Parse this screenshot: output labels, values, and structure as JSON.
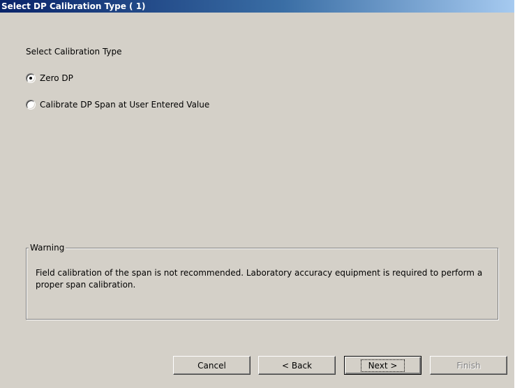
{
  "window": {
    "title": "Select DP Calibration Type ( 1)"
  },
  "calibration": {
    "label": "Select Calibration Type",
    "options": [
      {
        "label": "Zero DP",
        "selected": true
      },
      {
        "label": "Calibrate DP Span at User Entered Value",
        "selected": false
      }
    ]
  },
  "warning": {
    "title": "Warning",
    "message": "Field calibration of the span is not recommended. Laboratory accuracy equipment is required to perform a proper span calibration."
  },
  "buttons": {
    "cancel": "Cancel",
    "back": "< Back",
    "next": "Next >",
    "finish": "Finish"
  }
}
